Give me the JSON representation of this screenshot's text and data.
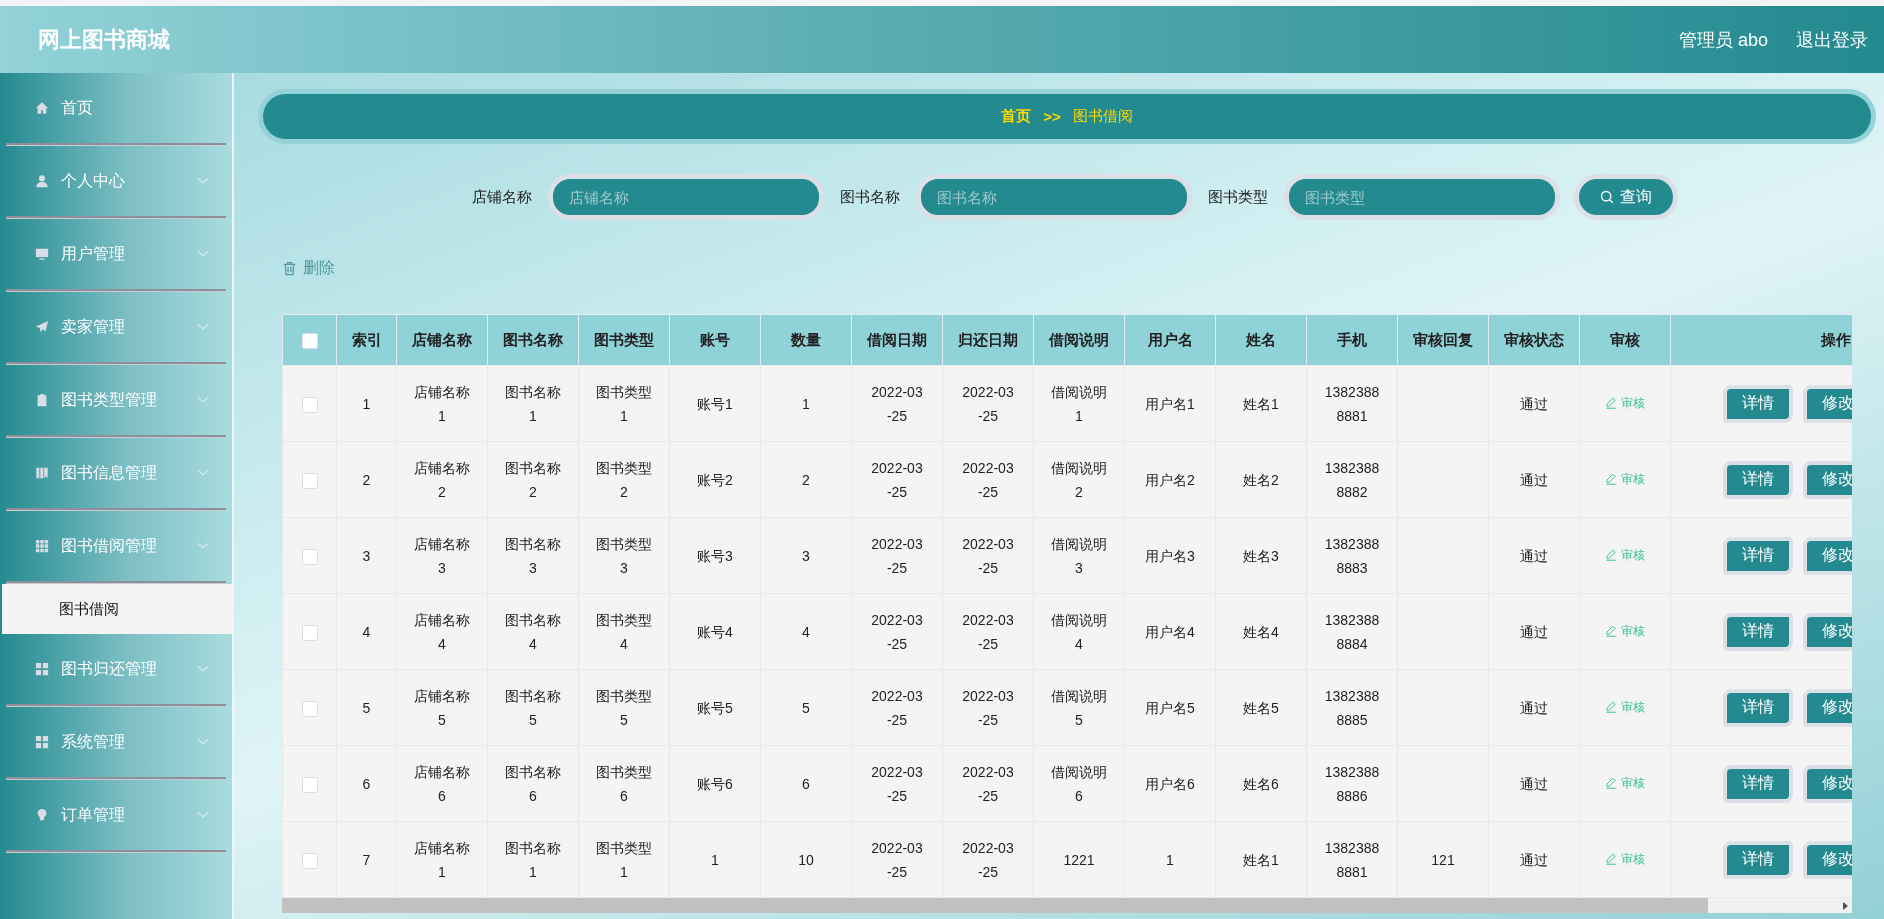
{
  "header": {
    "title": "网上图书商城",
    "user": "管理员 abo",
    "logout": "退出登录"
  },
  "sidebar": {
    "items": [
      {
        "label": "首页",
        "kind": "link"
      },
      {
        "label": "个人中心",
        "kind": "menu"
      },
      {
        "label": "用户管理",
        "kind": "menu"
      },
      {
        "label": "卖家管理",
        "kind": "menu"
      },
      {
        "label": "图书类型管理",
        "kind": "menu"
      },
      {
        "label": "图书信息管理",
        "kind": "menu"
      },
      {
        "label": "图书借阅管理",
        "kind": "menu",
        "children": [
          {
            "label": "图书借阅",
            "selected": true
          }
        ]
      },
      {
        "label": "图书归还管理",
        "kind": "menu"
      },
      {
        "label": "系统管理",
        "kind": "menu"
      },
      {
        "label": "订单管理",
        "kind": "menu"
      }
    ]
  },
  "breadcrumb": {
    "items": [
      "首页",
      "图书借阅"
    ],
    "separator": ">>"
  },
  "search": {
    "fields": [
      {
        "label": "店铺名称",
        "placeholder": "店铺名称"
      },
      {
        "label": "图书名称",
        "placeholder": "图书名称"
      },
      {
        "label": "图书类型",
        "placeholder": "图书类型"
      }
    ],
    "button": "查询"
  },
  "toolbar": {
    "delete": "删除"
  },
  "table": {
    "select_all_checked": false,
    "columns": [
      "索引",
      "店铺名称",
      "图书名称",
      "图书类型",
      "账号",
      "数量",
      "借阅日期",
      "归还日期",
      "借阅说明",
      "用户名",
      "姓名",
      "手机",
      "审核回复",
      "审核状态",
      "审核",
      "操作"
    ],
    "rows": [
      {
        "checked": false,
        "cells": [
          "1",
          "店铺名称1",
          "图书名称1",
          "图书类型1",
          "账号1",
          "1",
          "2022-03-25",
          "2022-03-25",
          "借阅说明1",
          "用户名1",
          "姓名1",
          "13823888881",
          "",
          "通过"
        ],
        "review": "审核",
        "buttons": [
          "详情",
          "修改"
        ]
      },
      {
        "checked": false,
        "cells": [
          "2",
          "店铺名称2",
          "图书名称2",
          "图书类型2",
          "账号2",
          "2",
          "2022-03-25",
          "2022-03-25",
          "借阅说明2",
          "用户名2",
          "姓名2",
          "13823888882",
          "",
          "通过"
        ],
        "review": "审核",
        "buttons": [
          "详情",
          "修改"
        ]
      },
      {
        "checked": false,
        "cells": [
          "3",
          "店铺名称3",
          "图书名称3",
          "图书类型3",
          "账号3",
          "3",
          "2022-03-25",
          "2022-03-25",
          "借阅说明3",
          "用户名3",
          "姓名3",
          "13823888883",
          "",
          "通过"
        ],
        "review": "审核",
        "buttons": [
          "详情",
          "修改"
        ]
      },
      {
        "checked": false,
        "cells": [
          "4",
          "店铺名称4",
          "图书名称4",
          "图书类型4",
          "账号4",
          "4",
          "2022-03-25",
          "2022-03-25",
          "借阅说明4",
          "用户名4",
          "姓名4",
          "13823888884",
          "",
          "通过"
        ],
        "review": "审核",
        "buttons": [
          "详情",
          "修改"
        ]
      },
      {
        "checked": false,
        "cells": [
          "5",
          "店铺名称5",
          "图书名称5",
          "图书类型5",
          "账号5",
          "5",
          "2022-03-25",
          "2022-03-25",
          "借阅说明5",
          "用户名5",
          "姓名5",
          "13823888885",
          "",
          "通过"
        ],
        "review": "审核",
        "buttons": [
          "详情",
          "修改"
        ]
      },
      {
        "checked": false,
        "cells": [
          "6",
          "店铺名称6",
          "图书名称6",
          "图书类型6",
          "账号6",
          "6",
          "2022-03-25",
          "2022-03-25",
          "借阅说明6",
          "用户名6",
          "姓名6",
          "13823888886",
          "",
          "通过"
        ],
        "review": "审核",
        "buttons": [
          "详情",
          "修改"
        ]
      },
      {
        "checked": false,
        "cells": [
          "7",
          "店铺名称1",
          "图书名称1",
          "图书类型1",
          "1",
          "10",
          "2022-03-25",
          "2022-03-25",
          "1221",
          "1",
          "姓名1",
          "13823888881",
          "121",
          "通过"
        ],
        "review": "审核",
        "buttons": [
          "详情",
          "修改"
        ]
      }
    ]
  }
}
